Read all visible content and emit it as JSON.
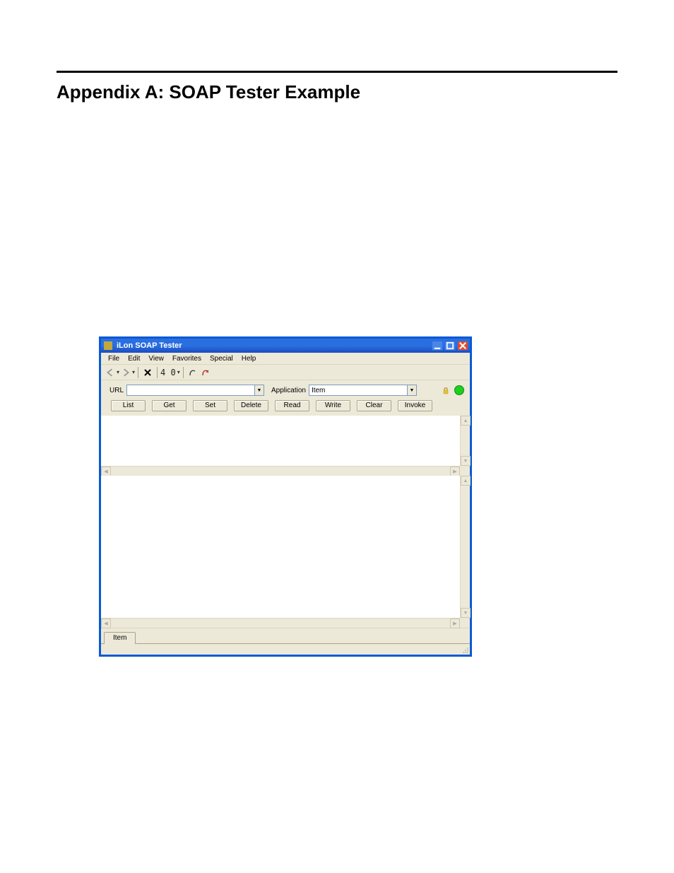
{
  "doc": {
    "heading": "Appendix A: SOAP Tester Example"
  },
  "window": {
    "title": "iLon SOAP Tester"
  },
  "menu": {
    "items": [
      "File",
      "Edit",
      "View",
      "Favorites",
      "Special",
      "Help"
    ]
  },
  "toolbar": {
    "zoom_text": "4 0"
  },
  "url_row": {
    "url_label": "URL",
    "url_value": "",
    "app_label": "Application",
    "app_value": "Item"
  },
  "buttons": {
    "items": [
      "List",
      "Get",
      "Set",
      "Delete",
      "Read",
      "Write",
      "Clear",
      "Invoke"
    ]
  },
  "tabs": {
    "items": [
      "Item"
    ]
  }
}
